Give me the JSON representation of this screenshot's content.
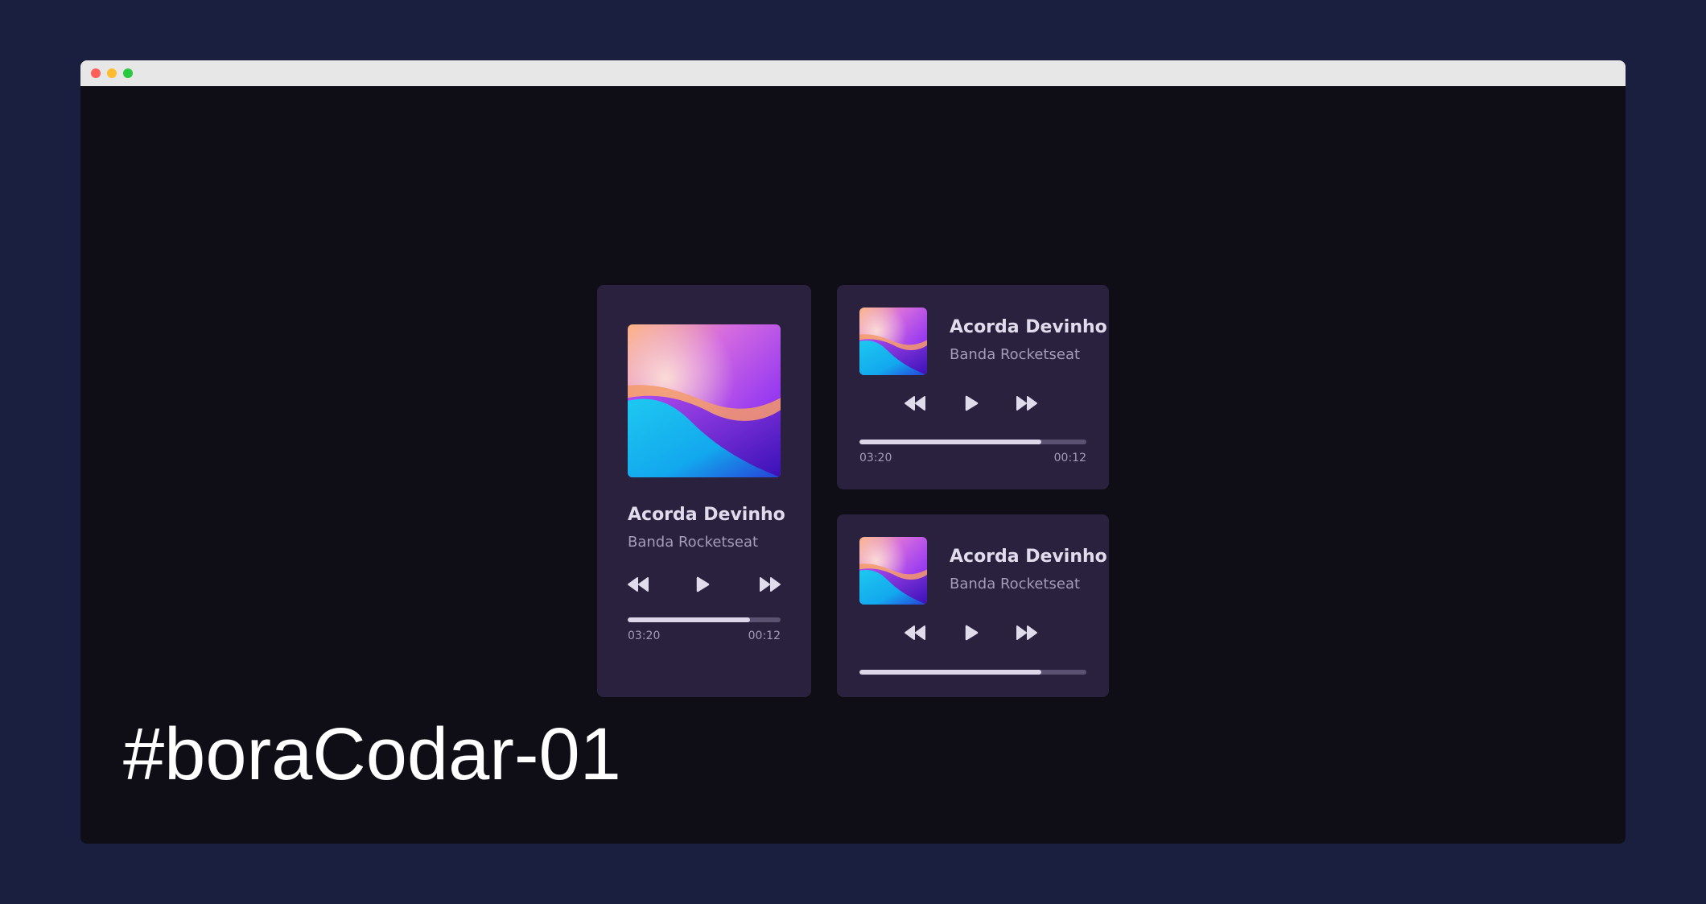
{
  "window": {
    "controls": [
      "close",
      "minimize",
      "maximize"
    ]
  },
  "players": [
    {
      "title": "Acorda Devinho",
      "artist": "Banda Rocketseat",
      "elapsed": "03:20",
      "remaining": "00:12",
      "progress": 0.8
    },
    {
      "title": "Acorda Devinho",
      "artist": "Banda Rocketseat",
      "elapsed": "03:20",
      "remaining": "00:12",
      "progress": 0.8
    },
    {
      "title": "Acorda Devinho",
      "artist": "Banda Rocketseat",
      "progress": 0.8
    }
  ],
  "icons": {
    "rewind": "rewind-icon",
    "play": "play-icon",
    "forward": "fast-forward-icon"
  },
  "colors": {
    "page_background": "#1a1f3f",
    "window_background": "#0f0d15",
    "card_background": "#2a213f",
    "title": "#e1dcec",
    "artist": "#a59cb9",
    "progress_fill": "#dcd6e8",
    "progress_track": "#5a5270"
  },
  "caption": "#boraCodar-01"
}
